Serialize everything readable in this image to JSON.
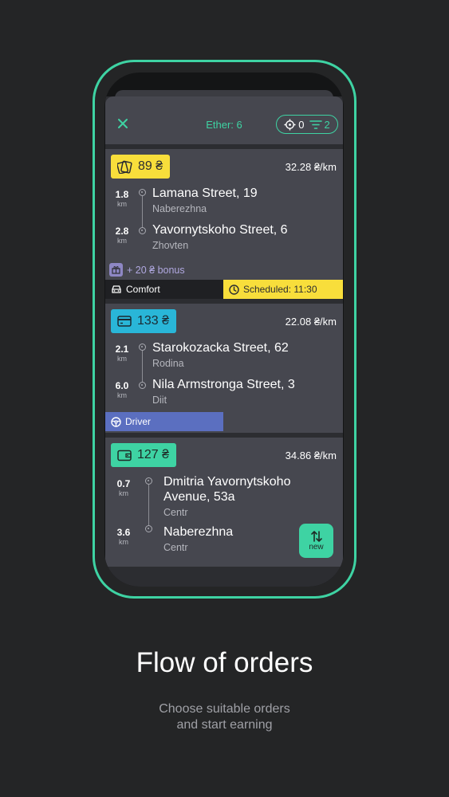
{
  "header": {
    "ether_label": "Ether: 6",
    "location_count": "0",
    "filter_count": "2"
  },
  "orders": [
    {
      "price": "89 ₴",
      "price_color": "#f8de3b",
      "payment_icon": "cash-icon",
      "rate": "32.28 ₴/km",
      "from": {
        "distance": "1.8",
        "unit": "km",
        "street": "Lamana Street, 19",
        "district": "Naberezhna"
      },
      "to": {
        "distance": "2.8",
        "unit": "km",
        "street": "Yavornytskoho Street, 6",
        "district": "Zhovten"
      },
      "bonus": "+ 20 ₴ bonus",
      "class_label": "Comfort",
      "scheduled_label": "Scheduled: 11:30"
    },
    {
      "price": "133 ₴",
      "price_color": "#29b6d8",
      "payment_icon": "card-icon",
      "rate": "22.08 ₴/km",
      "from": {
        "distance": "2.1",
        "unit": "km",
        "street": "Starokozacka Street, 62",
        "district": "Rodina"
      },
      "to": {
        "distance": "6.0",
        "unit": "km",
        "street": "Nila Armstronga Street, 3",
        "district": "Diit"
      },
      "class_label": "Driver"
    },
    {
      "price": "127 ₴",
      "price_color": "#3ed3a3",
      "payment_icon": "wallet-icon",
      "rate": "34.86 ₴/km",
      "from": {
        "distance": "0.7",
        "unit": "km",
        "street_line1": "Dmitria Yavornytskoho",
        "street_line2": "Avenue, 53a",
        "district": "Centr"
      },
      "to": {
        "distance": "3.6",
        "unit": "km",
        "street": "Naberezhna",
        "district": "Centr"
      },
      "new_label": "new"
    }
  ],
  "promo": {
    "title": "Flow of orders",
    "subtitle_line1": "Choose suitable orders",
    "subtitle_line2": "and start earning"
  },
  "colors": {
    "accent": "#3ed3a3",
    "scheduled": "#f8de3b",
    "driver_tag": "#5b6fc0",
    "comfort_tag": "#1f2023"
  }
}
